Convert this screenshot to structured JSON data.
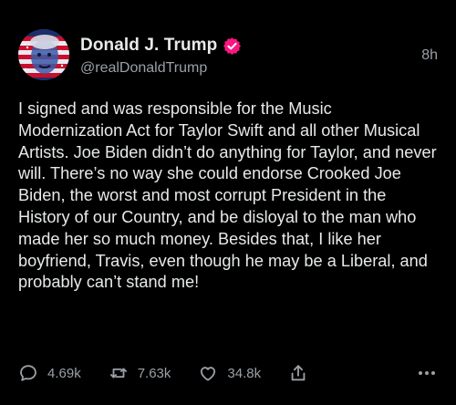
{
  "post": {
    "display_name": "Donald J. Trump",
    "handle": "@realDonaldTrump",
    "time": "8h",
    "body": "I signed and was responsible for the Music Modernization Act for Taylor Swift and all other Musical Artists. Joe Biden didn’t do anything for Taylor, and never will. There’s no way she could endorse Crooked Joe Biden, the worst and most corrupt President in the History of our Country, and be disloyal to the man who made her so much money. Besides that, I like her boyfriend, Travis, even though he may be a Liberal, and probably can’t stand me!",
    "verified_color": "#f91880"
  },
  "actions": {
    "replies": "4.69k",
    "reposts": "7.63k",
    "likes": "34.8k"
  },
  "icons": {
    "reply": "comment-bubble-icon",
    "repost": "repost-arrows-icon",
    "like": "heart-icon",
    "share": "share-upload-icon",
    "more": "more-dots-icon",
    "verified": "verified-badge-icon"
  },
  "colors": {
    "background": "#000000",
    "primary_text": "#e7e9ea",
    "secondary_text": "#9aa0a6"
  }
}
